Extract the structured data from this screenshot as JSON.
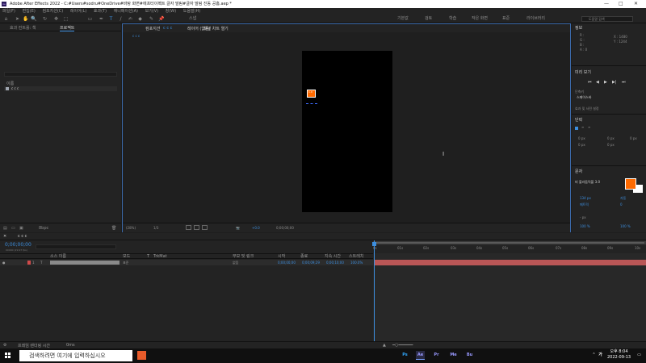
{
  "window": {
    "title": "Adobe After Effects 2022 - C:#Users#sodru#OneDrive#바탕 화면#에프터이펙트 글자 말림#글자 말림 진동 공홈.aep *",
    "controls": [
      "—",
      "□",
      "✕"
    ]
  },
  "menu": [
    "파일(F)",
    "편집(E)",
    "컴포지션(C)",
    "레이어(L)",
    "효과(T)",
    "애니메이션(A)",
    "보기(V)",
    "창(W)",
    "도움말(H)"
  ],
  "toolbar": {
    "tools": [
      "⌂",
      "➤",
      "✋",
      "🔍",
      "↻",
      "✥",
      "⬚",
      "▭",
      "✒",
      "T",
      "/",
      "✍",
      "◆",
      "✎",
      "📌"
    ],
    "snapping": "스냅",
    "workspaces": [
      "기본값",
      "검토",
      "학습",
      "작은 화면",
      "표준",
      "라이브러리"
    ],
    "search_placeholder": "도움말 검색"
  },
  "project_panel": {
    "tabs": [
      "효과 컨트롤: 책",
      "프로젝트"
    ],
    "column_name": "이름",
    "items": [
      {
        "name": "c c c"
      }
    ],
    "footer_bpc": "8bpc"
  },
  "comp_panel": {
    "tab": "컴포지션",
    "tab_name": "c c c",
    "lock_label": "레이어 (없음)",
    "flow_label": "패널 차트 열기",
    "sub_tab": "c c c",
    "layer_label": "1.0",
    "footer": {
      "zoom": "(28%)",
      "resolution": "1/3",
      "exposure": "+0.0",
      "timecode": "0;00;00;00"
    }
  },
  "right_panel": {
    "info_head": "정보",
    "info_values": [
      "R :",
      "G :",
      "B :",
      "A : 0"
    ],
    "coords": [
      "X : 1480",
      "Y : 1244"
    ],
    "preview_head": "미리 보기",
    "shortcut_label": "단축키",
    "shortcut_value": "스페이스바",
    "effects_head": "효과 및 사전 설정",
    "align_head": "단락",
    "char_head": "문자",
    "font_name": "비 볼라듐릭볼 3.0",
    "font_size": "134 px",
    "leading": "자동",
    "tracking": "메트릭",
    "tracking_value": "0",
    "stroke_label": "- px",
    "scale_h": "100 %",
    "scale_v": "100 %",
    "paragraph_values": [
      "0 px",
      "0 px",
      "0 px",
      "0 px",
      "0 px"
    ]
  },
  "timeline": {
    "tab": "c c c",
    "timecode": "0;00;00;00",
    "fps": "00000 (29.97 fps)",
    "columns": [
      "소스 이름",
      "모드",
      "T",
      "TrkMat",
      "부모 및 링크",
      "시작",
      "종료",
      "지속 시간",
      "스트레치"
    ],
    "layers": [
      {
        "num": "1",
        "name": "",
        "mode": "표준",
        "parent": "없음",
        "in": "0;00;00;00",
        "out": "0;00;09;29",
        "duration": "0;00;10;00",
        "stretch": "100.0%"
      }
    ],
    "ruler": [
      "0s",
      "01s",
      "02s",
      "03s",
      "04s",
      "05s",
      "06s",
      "07s",
      "08s",
      "09s",
      "10s"
    ],
    "footer_label": "프레임 렌더링 시간",
    "footer_value": "0ms"
  },
  "taskbar": {
    "search_placeholder": "검색하려면 여기에 입력하십시오",
    "apps": [
      "Ps",
      "Ae",
      "Pr",
      "Me",
      "Bu"
    ],
    "time": "오후 8:04",
    "date": "2022-09-13",
    "lang": "가"
  },
  "colors": {
    "accent": "#3d8fdf",
    "layer_bar": "#b95656",
    "fill_color": "#ff6a00"
  }
}
